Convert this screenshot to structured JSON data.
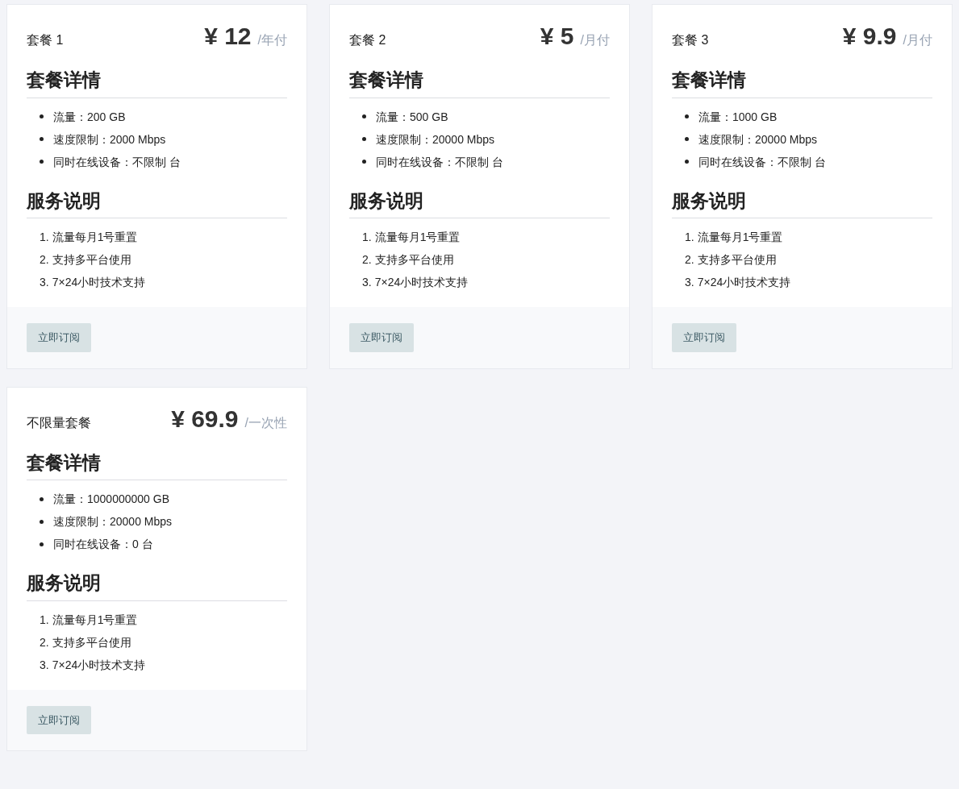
{
  "plans": [
    {
      "name": "套餐 1",
      "currency": "¥",
      "price": "12",
      "period": "/年付",
      "details_title": "套餐详情",
      "details": [
        "流量：200 GB",
        "速度限制：2000 Mbps",
        "同时在线设备：不限制 台"
      ],
      "service_title": "服务说明",
      "services": [
        {
          "marker": "1.",
          "text": "流量每月1号重置"
        },
        {
          "marker": "2.",
          "text": "支持多平台使用"
        },
        {
          "marker": "3.",
          "text": "7×24小时技术支持"
        }
      ],
      "button": "立即订阅"
    },
    {
      "name": "套餐 2",
      "currency": "¥",
      "price": "5",
      "period": "/月付",
      "details_title": "套餐详情",
      "details": [
        "流量：500 GB",
        "速度限制：20000 Mbps",
        "同时在线设备：不限制 台"
      ],
      "service_title": "服务说明",
      "services": [
        {
          "marker": "1.",
          "text": "流量每月1号重置"
        },
        {
          "marker": "2.",
          "text": "支持多平台使用"
        },
        {
          "marker": "3.",
          "text": "7×24小时技术支持"
        }
      ],
      "button": "立即订阅"
    },
    {
      "name": "套餐 3",
      "currency": "¥",
      "price": "9.9",
      "period": "/月付",
      "details_title": "套餐详情",
      "details": [
        "流量：1000 GB",
        "速度限制：20000 Mbps",
        "同时在线设备：不限制 台"
      ],
      "service_title": "服务说明",
      "services": [
        {
          "marker": "1.",
          "text": "流量每月1号重置"
        },
        {
          "marker": "2.",
          "text": "支持多平台使用"
        },
        {
          "marker": "3.",
          "text": "7×24小时技术支持"
        }
      ],
      "button": "立即订阅"
    },
    {
      "name": "不限量套餐",
      "currency": "¥",
      "price": "69.9",
      "period": "/一次性",
      "details_title": "套餐详情",
      "details": [
        "流量：1000000000 GB",
        "速度限制：20000 Mbps",
        "同时在线设备：0 台"
      ],
      "service_title": "服务说明",
      "services": [
        {
          "marker": "1.",
          "text": "流量每月1号重置"
        },
        {
          "marker": "2.",
          "text": "支持多平台使用"
        },
        {
          "marker": "3.",
          "text": "7×24小时技术支持"
        }
      ],
      "button": "立即订阅"
    }
  ]
}
